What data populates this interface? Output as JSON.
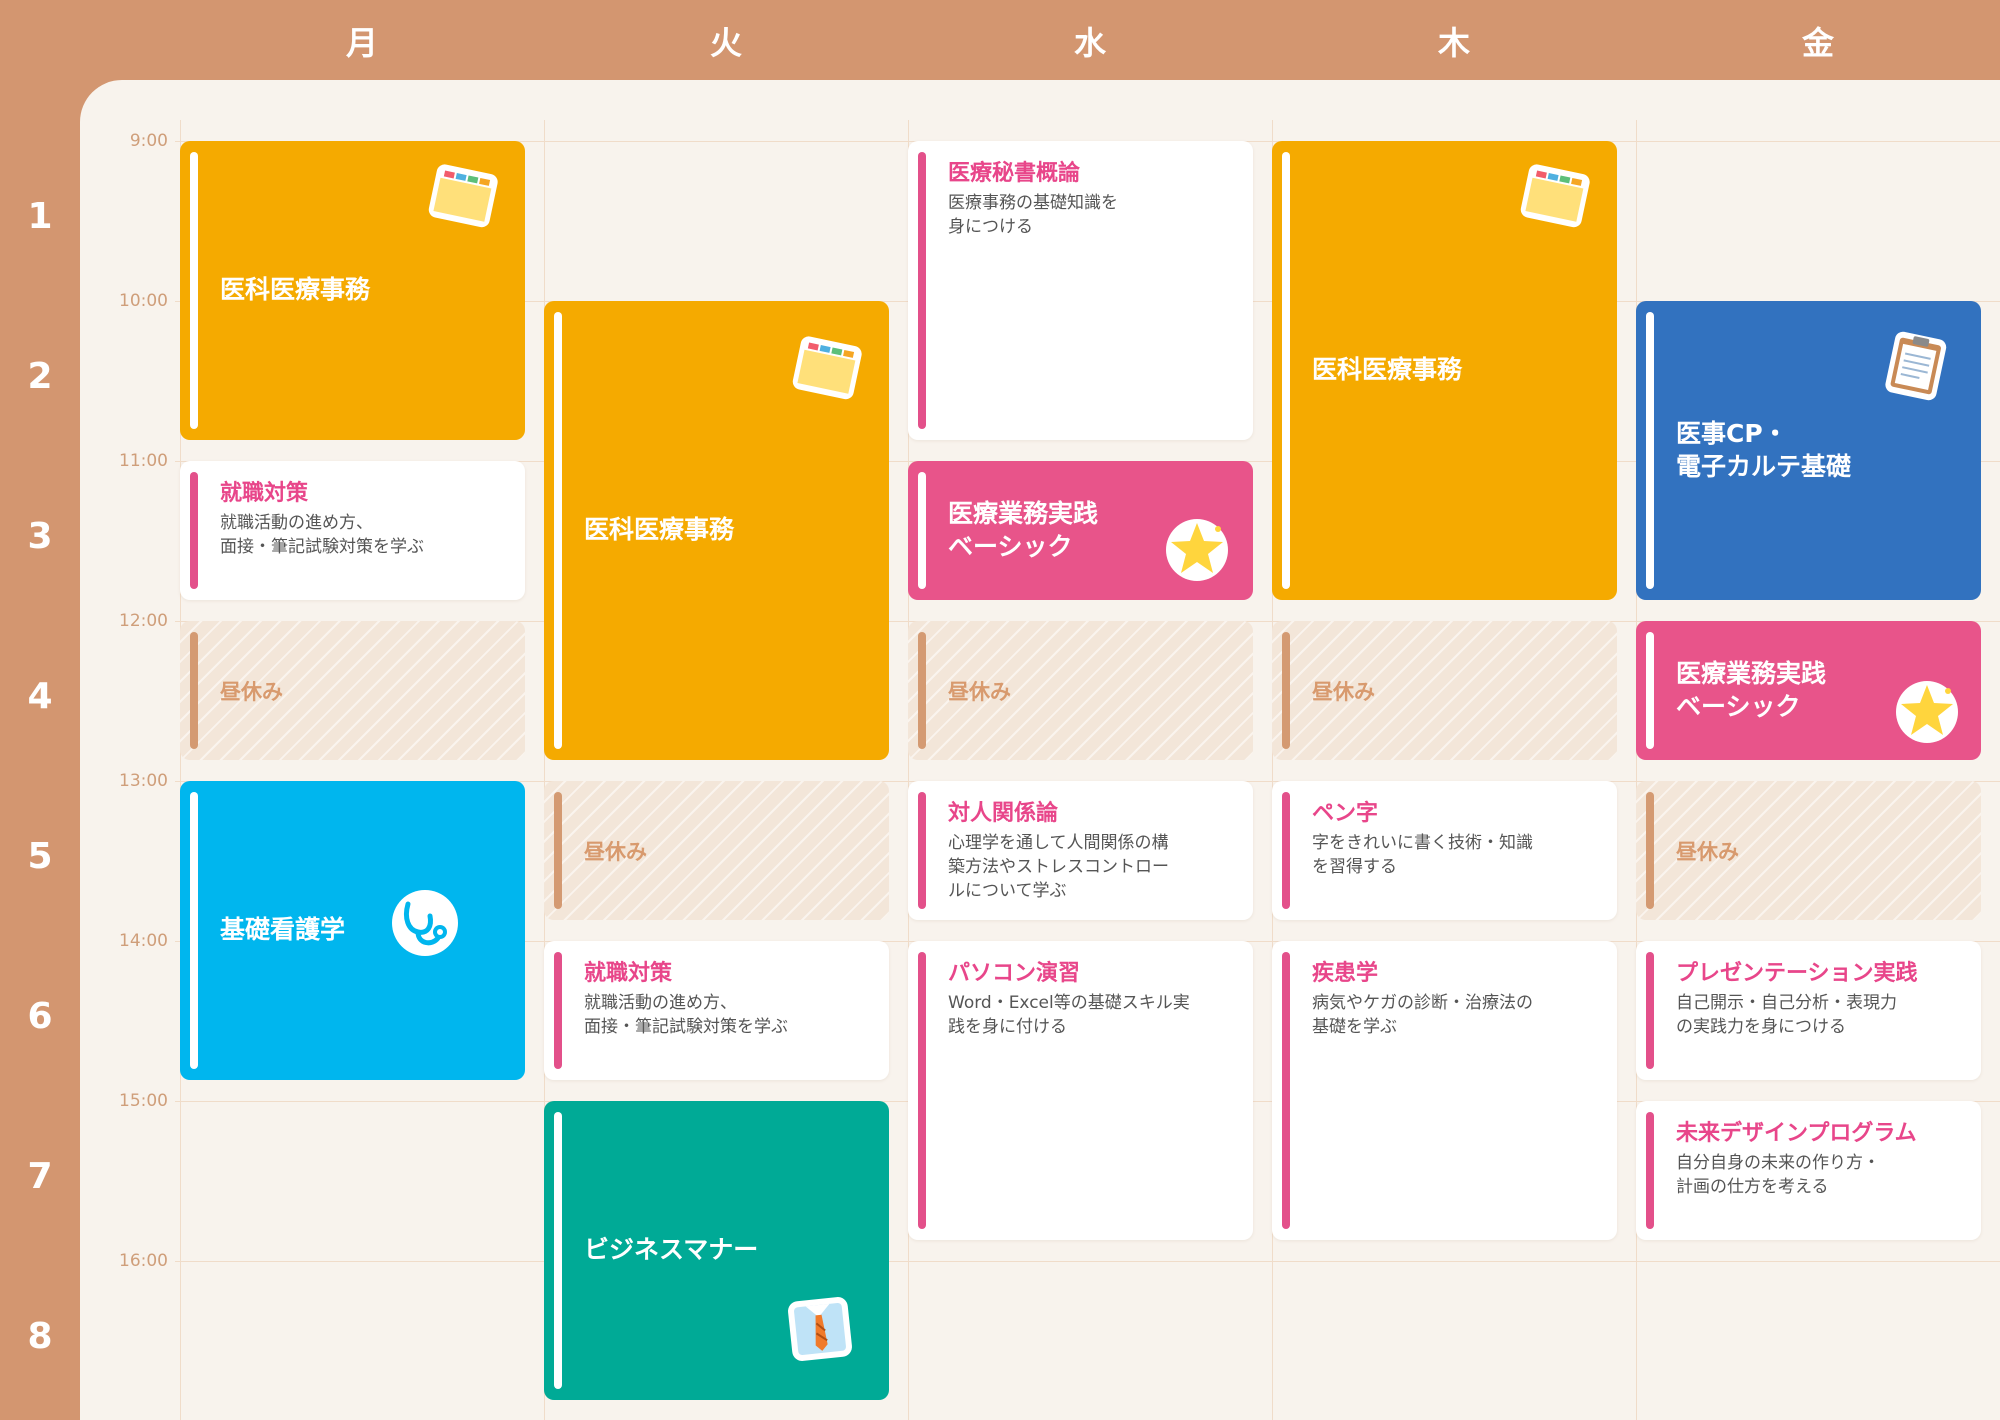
{
  "days": [
    "月",
    "火",
    "水",
    "木",
    "金"
  ],
  "periods": [
    "1",
    "2",
    "3",
    "4",
    "5",
    "6",
    "7",
    "8"
  ],
  "times": [
    "9:00",
    "10:00",
    "11:00",
    "12:00",
    "13:00",
    "14:00",
    "15:00",
    "16:00"
  ],
  "colors": {
    "frame": "#D39670",
    "panel": "#F8F3ED",
    "orange": "#F5AA00",
    "blue": "#3272BF",
    "cyan": "#00B6EE",
    "green": "#00AA96",
    "pink": "#E8548A",
    "accent_text": "#E8468A",
    "lunch": "#F3E6D9"
  },
  "classes": {
    "mon_p1": {
      "title": "医科医療事務",
      "icon": "folder-icon"
    },
    "mon_p3": {
      "title": "就職対策",
      "desc": "就職活動の進め方、\n面接・筆記試験対策を学ぶ"
    },
    "mon_p4": {
      "title": "昼休み"
    },
    "mon_p5": {
      "title": "基礎看護学",
      "icon": "stethoscope-icon"
    },
    "tue_p2": {
      "title": "医科医療事務",
      "icon": "folder-icon"
    },
    "tue_p5": {
      "title": "昼休み"
    },
    "tue_p6": {
      "title": "就職対策",
      "desc": "就職活動の進め方、\n面接・筆記試験対策を学ぶ"
    },
    "tue_p7": {
      "title": "ビジネスマナー",
      "icon": "shirt-tie-icon"
    },
    "wed_p1": {
      "title": "医療秘書概論",
      "desc": "医療事務の基礎知識を\n身につける"
    },
    "wed_p3": {
      "title": "医療業務実践\nベーシック",
      "icon": "star-icon"
    },
    "wed_p4": {
      "title": "昼休み"
    },
    "wed_p5": {
      "title": "対人関係論",
      "desc": "心理学を通して人間関係の構\n築方法やストレスコントロー\nルについて学ぶ"
    },
    "wed_p6": {
      "title": "パソコン演習",
      "desc": "Word・Excel等の基礎スキル実\n践を身に付ける"
    },
    "thu_p1": {
      "title": "医科医療事務",
      "icon": "folder-icon"
    },
    "thu_p4": {
      "title": "昼休み"
    },
    "thu_p5": {
      "title": "ペン字",
      "desc": "字をきれいに書く技術・知識\nを習得する"
    },
    "thu_p6": {
      "title": "疾患学",
      "desc": "病気やケガの診断・治療法の\n基礎を学ぶ"
    },
    "fri_p2": {
      "title": "医事CP・\n電子カルテ基礎",
      "icon": "clipboard-icon"
    },
    "fri_p4": {
      "title": "医療業務実践\nベーシック",
      "icon": "star-icon"
    },
    "fri_p5": {
      "title": "昼休み"
    },
    "fri_p6": {
      "title": "プレゼンテーション実践",
      "desc": "自己開示・自己分析・表現力\nの実践力を身につける"
    },
    "fri_p7": {
      "title": "未来デザインプログラム",
      "desc": "自分自身の未来の作り方・\n計画の仕方を考える"
    }
  }
}
